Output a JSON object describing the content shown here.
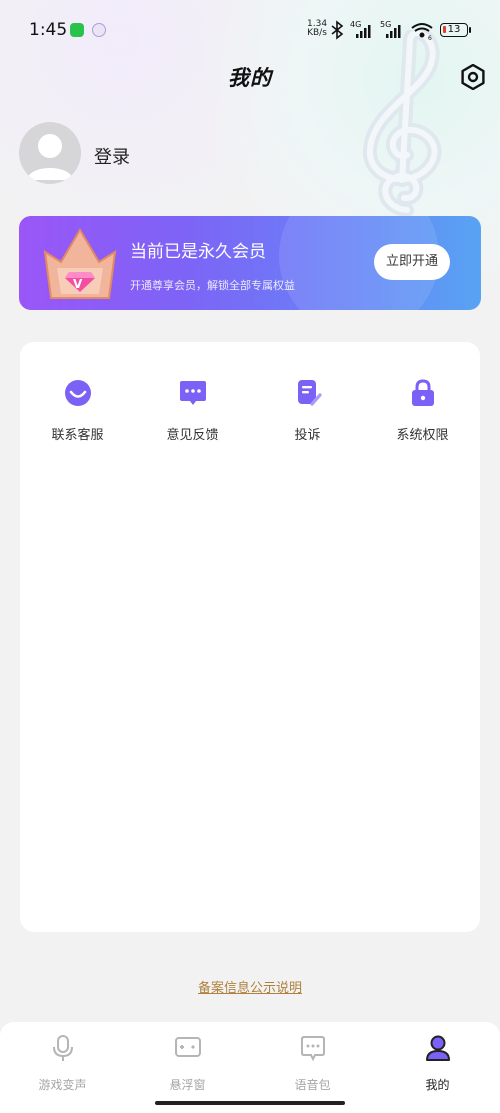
{
  "status_bar": {
    "time": "1:45",
    "net_speed_value": "1.34",
    "net_speed_unit": "KB/s",
    "signal_4g": "4G",
    "signal_5g": "5G",
    "wifi_label": "6",
    "battery": "13"
  },
  "header": {
    "title": "我的"
  },
  "profile": {
    "login_label": "登录"
  },
  "vip": {
    "title": "当前已是永久会员",
    "subtitle": "开通尊享会员，解锁全部专属权益",
    "button_label": "立即开通"
  },
  "menu": {
    "items": [
      {
        "label": "联系客服",
        "icon": "smile-chat-icon"
      },
      {
        "label": "意见反馈",
        "icon": "feedback-bubble-icon"
      },
      {
        "label": "投诉",
        "icon": "complaint-doc-icon"
      },
      {
        "label": "系统权限",
        "icon": "lock-icon"
      }
    ]
  },
  "footer_link": "备案信息公示说明",
  "tabbar": {
    "tabs": [
      {
        "label": "游戏变声",
        "icon": "microphone-icon",
        "active": false
      },
      {
        "label": "悬浮窗",
        "icon": "floating-window-icon",
        "active": false
      },
      {
        "label": "语音包",
        "icon": "voice-pack-icon",
        "active": false
      },
      {
        "label": "我的",
        "icon": "user-icon",
        "active": true
      }
    ]
  },
  "colors": {
    "accent_purple": "#7b61f5",
    "vip_gradient_start": "#9a56f7",
    "vip_gradient_end": "#58a3f3",
    "link_color": "#b0803d",
    "battery_low": "#e53935"
  }
}
